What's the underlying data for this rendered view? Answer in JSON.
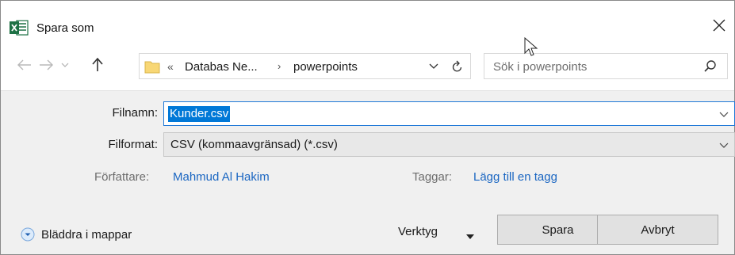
{
  "window": {
    "title": "Spara som",
    "app_icon": "excel-icon",
    "close_icon": "close-icon"
  },
  "nav": {
    "back_icon": "back-arrow-icon",
    "forward_icon": "forward-arrow-icon",
    "recent_icon": "chevron-down-icon",
    "up_icon": "up-arrow-icon",
    "breadcrumb_prefix": "«",
    "breadcrumb_parent": "Databas Ne...",
    "breadcrumb_separator": "›",
    "breadcrumb_current": "powerpoints",
    "refresh_icon": "refresh-icon",
    "search_placeholder": "Sök i powerpoints",
    "search_icon": "search-icon"
  },
  "form": {
    "filename_label": "Filnamn:",
    "filename_value": "Kunder.csv",
    "format_label": "Filformat:",
    "format_value": "CSV (kommaavgränsad) (*.csv)",
    "author_label": "Författare:",
    "author_value": "Mahmud Al Hakim",
    "tags_label": "Taggar:",
    "tags_value": "Lägg till en tagg"
  },
  "footer": {
    "browse_label": "Bläddra i mappar",
    "tools_label": "Verktyg",
    "save_label": "Spara",
    "cancel_label": "Avbryt"
  },
  "colors": {
    "accent": "#0078d7",
    "link": "#1a66c2",
    "panel_bg": "#f0f0f0",
    "excel_green": "#1e7145"
  }
}
